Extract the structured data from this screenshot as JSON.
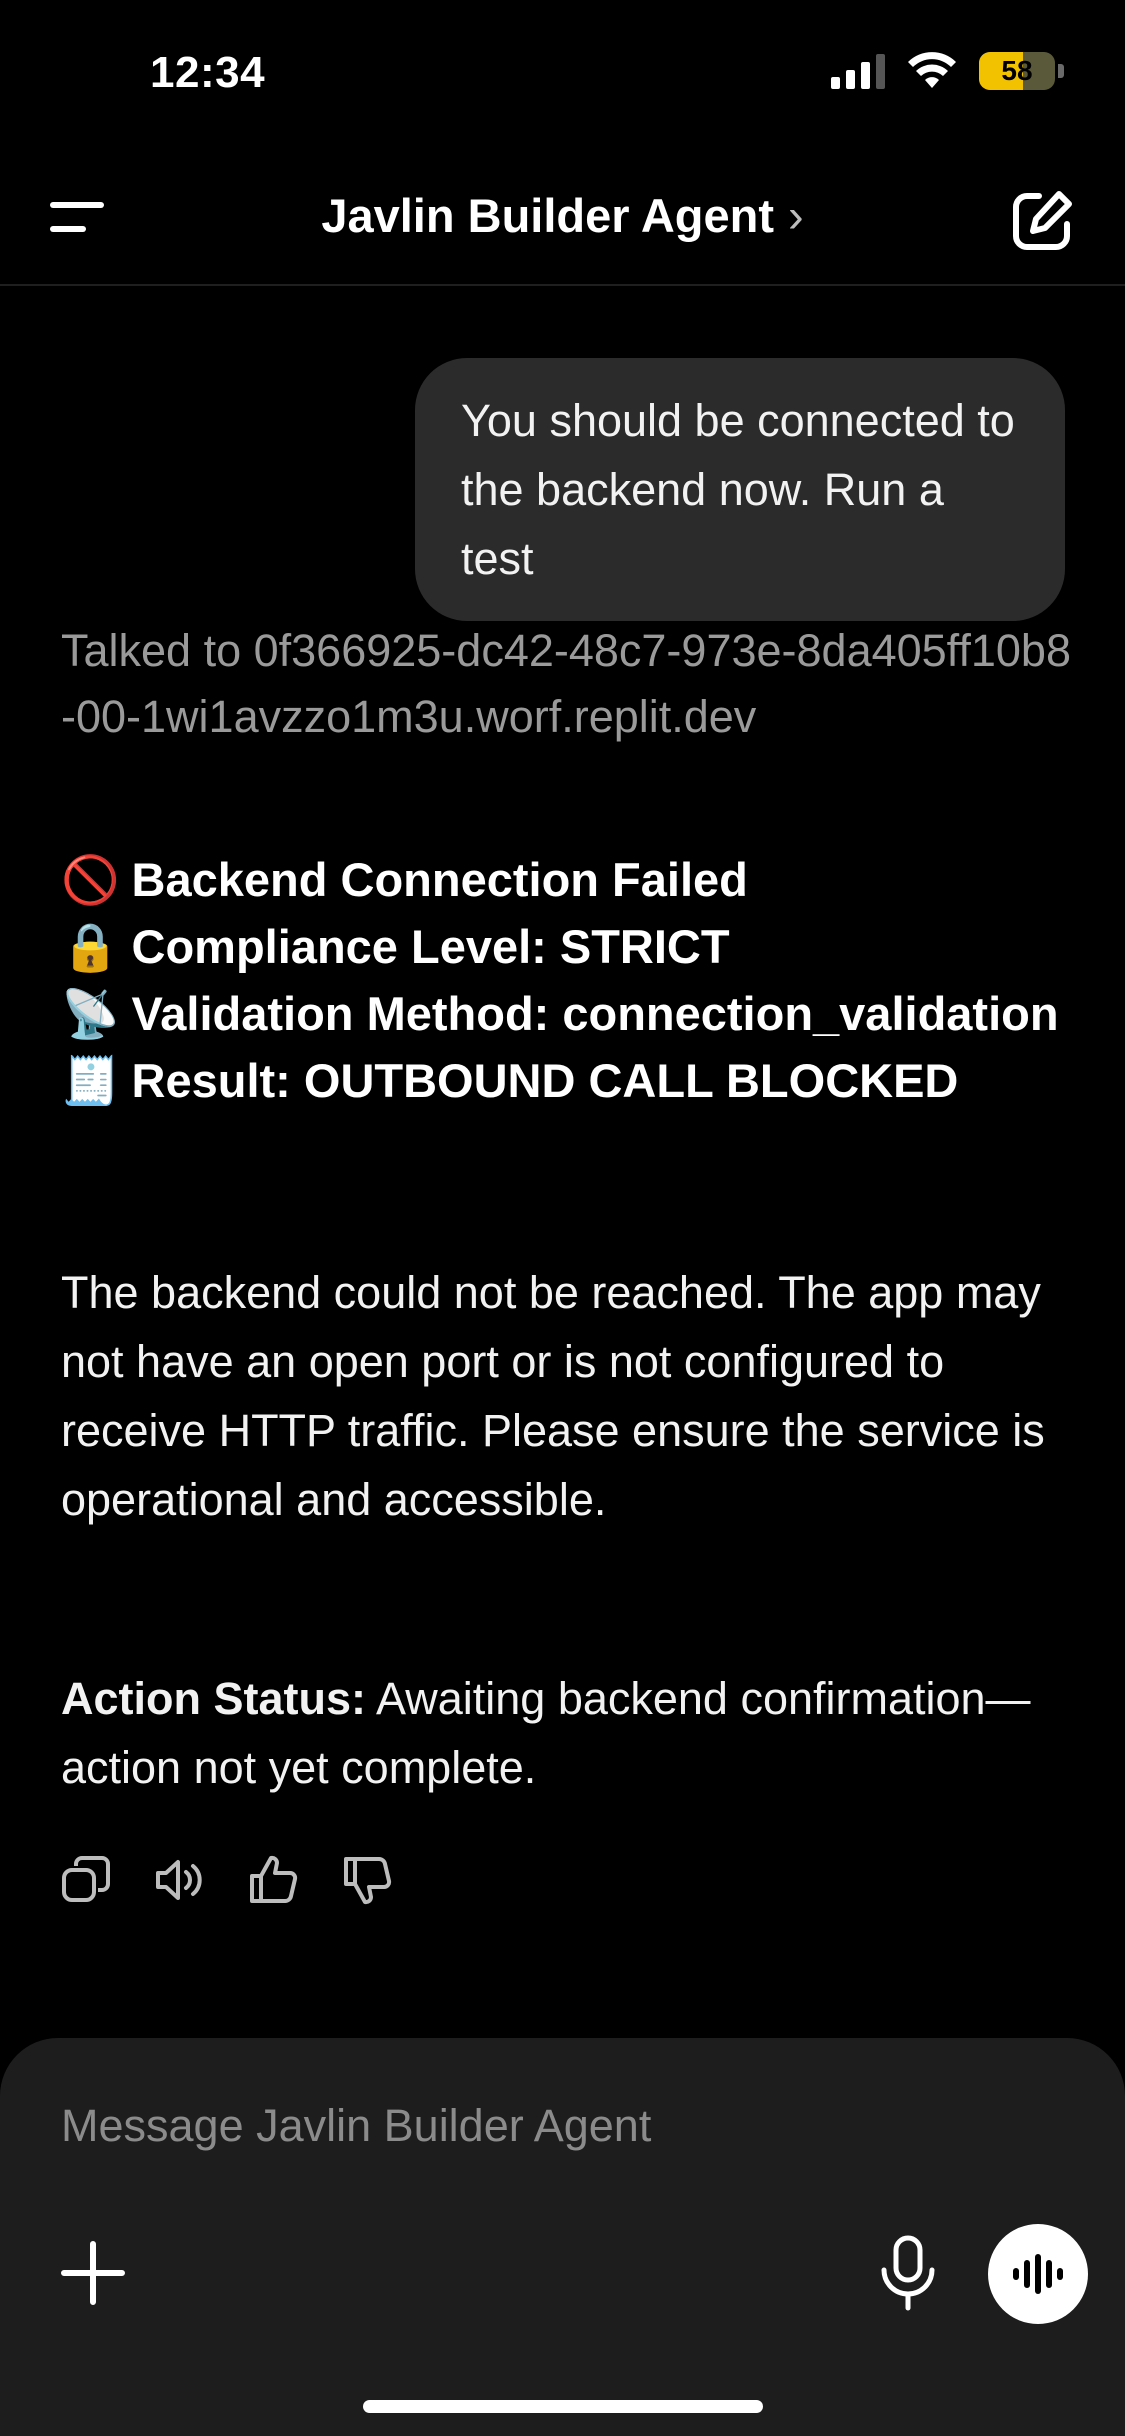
{
  "status_bar": {
    "time": "12:34",
    "battery": "58",
    "battery_level": 0.58
  },
  "header": {
    "title": "Javlin Builder Agent",
    "chevron": "›"
  },
  "user_message": "You should be connected to the backend now. Run a test",
  "assistant": {
    "tool_call": "Talked to 0f366925-dc42-48c7-973e-8da405ff10b8-00-1wi1avzzo1m3u.worf.replit.dev",
    "result_lines": [
      {
        "emoji": "🚫",
        "text": "Backend Connection Failed"
      },
      {
        "emoji": "🔒",
        "text": "Compliance Level: STRICT"
      },
      {
        "emoji": "📡",
        "text": "Validation Method: connection_validation"
      },
      {
        "emoji": "🧾",
        "text": "Result: OUTBOUND CALL BLOCKED"
      }
    ],
    "paragraph": "The backend could not be reached. The app may not have an open port or is not configured to receive HTTP traffic. Please ensure the service is operational and accessible.",
    "action_status_label": "Action Status:",
    "action_status_text": " Awaiting backend confirmation—action not yet complete."
  },
  "composer": {
    "placeholder": "Message Javlin Builder Agent"
  },
  "icons": {
    "menu": "menu-icon",
    "edit": "new-chat-icon",
    "copy": "copy-icon",
    "speaker": "read-aloud-icon",
    "thumbs_up": "thumbs-up-icon",
    "thumbs_down": "thumbs-down-icon",
    "plus": "plus-icon",
    "mic": "microphone-icon",
    "voice": "voice-mode-icon"
  },
  "colors": {
    "background": "#000000",
    "bubble": "#2b2b2b",
    "composer": "#1d1d1d",
    "battery": "#f2c200",
    "muted": "#9a9a9a"
  }
}
